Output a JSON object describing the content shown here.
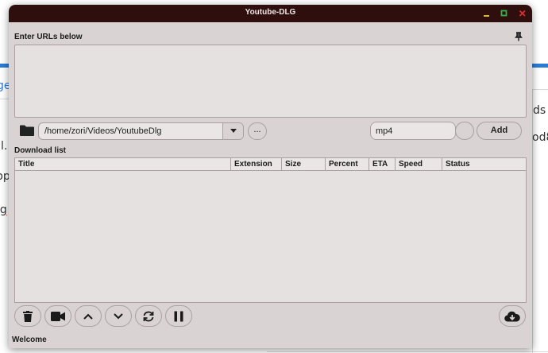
{
  "background": {
    "fragments": [
      "ge",
      "l.",
      "pp",
      "lg",
      "ds t",
      "od8"
    ]
  },
  "window": {
    "title": "Youtube-DLG"
  },
  "urls": {
    "label": "Enter URLs below",
    "value": ""
  },
  "path": {
    "value": "/home/zori/Videos/YoutubeDlg",
    "browse_label": "..."
  },
  "format": {
    "value": "mp4"
  },
  "add_label": "Add",
  "download_list": {
    "label": "Download list",
    "columns": [
      "Title",
      "Extension",
      "Size",
      "Percent",
      "ETA",
      "Speed",
      "Status"
    ]
  },
  "status_bar": {
    "text": "Welcome"
  },
  "icons": {
    "delete": "trash-icon",
    "play": "video-camera-icon",
    "up": "chevron-up-icon",
    "down": "chevron-down-icon",
    "reload": "reload-icon",
    "pause": "pause-icon",
    "start": "cloud-download-icon"
  },
  "colors": {
    "titlebar": "#2f0e0e",
    "window": "#d9d3d3",
    "minimize": "#e0c000",
    "maximize": "#2fb84a",
    "close": "#d83030",
    "accent_blue": "#2b7bd6"
  }
}
